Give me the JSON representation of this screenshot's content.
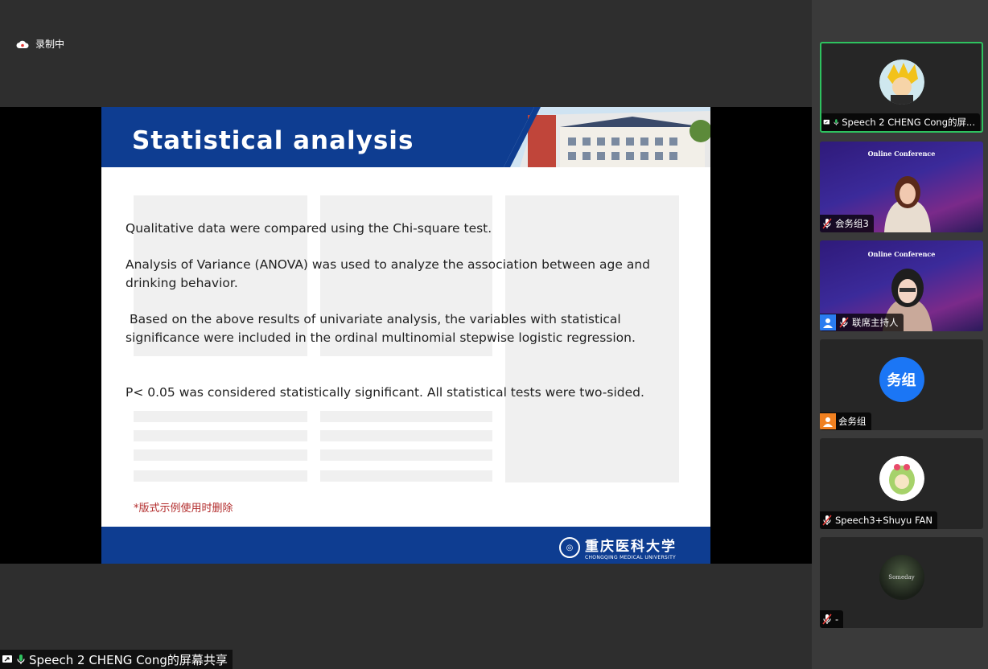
{
  "recording": {
    "status": "录制中"
  },
  "slide": {
    "title": "Statistical analysis",
    "paragraphs": [
      "Qualitative data were compared using the Chi-square test.",
      "Analysis of Variance (ANOVA) was used to analyze the association between age and drinking behavior.",
      " Based on the above results of univariate analysis, the variables with statistical significance were included in the ordinal multinomial stepwise logistic regression.",
      "P< 0.05 was considered statistically significant. All statistical tests were two-sided."
    ],
    "note": "*版式示例使用时删除",
    "logo_cn": "重庆医科大学",
    "logo_en": "CHONGQING MEDICAL UNIVERSITY"
  },
  "share_label": "Speech 2 CHENG Cong的屏幕共享",
  "participants": [
    {
      "name": "Speech 2 CHENG Cong的屏...",
      "active": true,
      "avatar": "cartoon-avatar"
    },
    {
      "name": "会务组3",
      "conference_title": "Online Conference"
    },
    {
      "name": "联席主持人",
      "conference_title": "Online Conference"
    },
    {
      "name": "会务组",
      "initials": "务组"
    },
    {
      "name": "Speech3+Shuyu FAN",
      "avatar": "cartoon-avatar"
    },
    {
      "name": "-",
      "avatar_text": "Someday"
    }
  ],
  "colors": {
    "slide_blue": "#0e3d91",
    "active_border": "#2ec25f",
    "avatar_blue": "#1b76f5"
  }
}
